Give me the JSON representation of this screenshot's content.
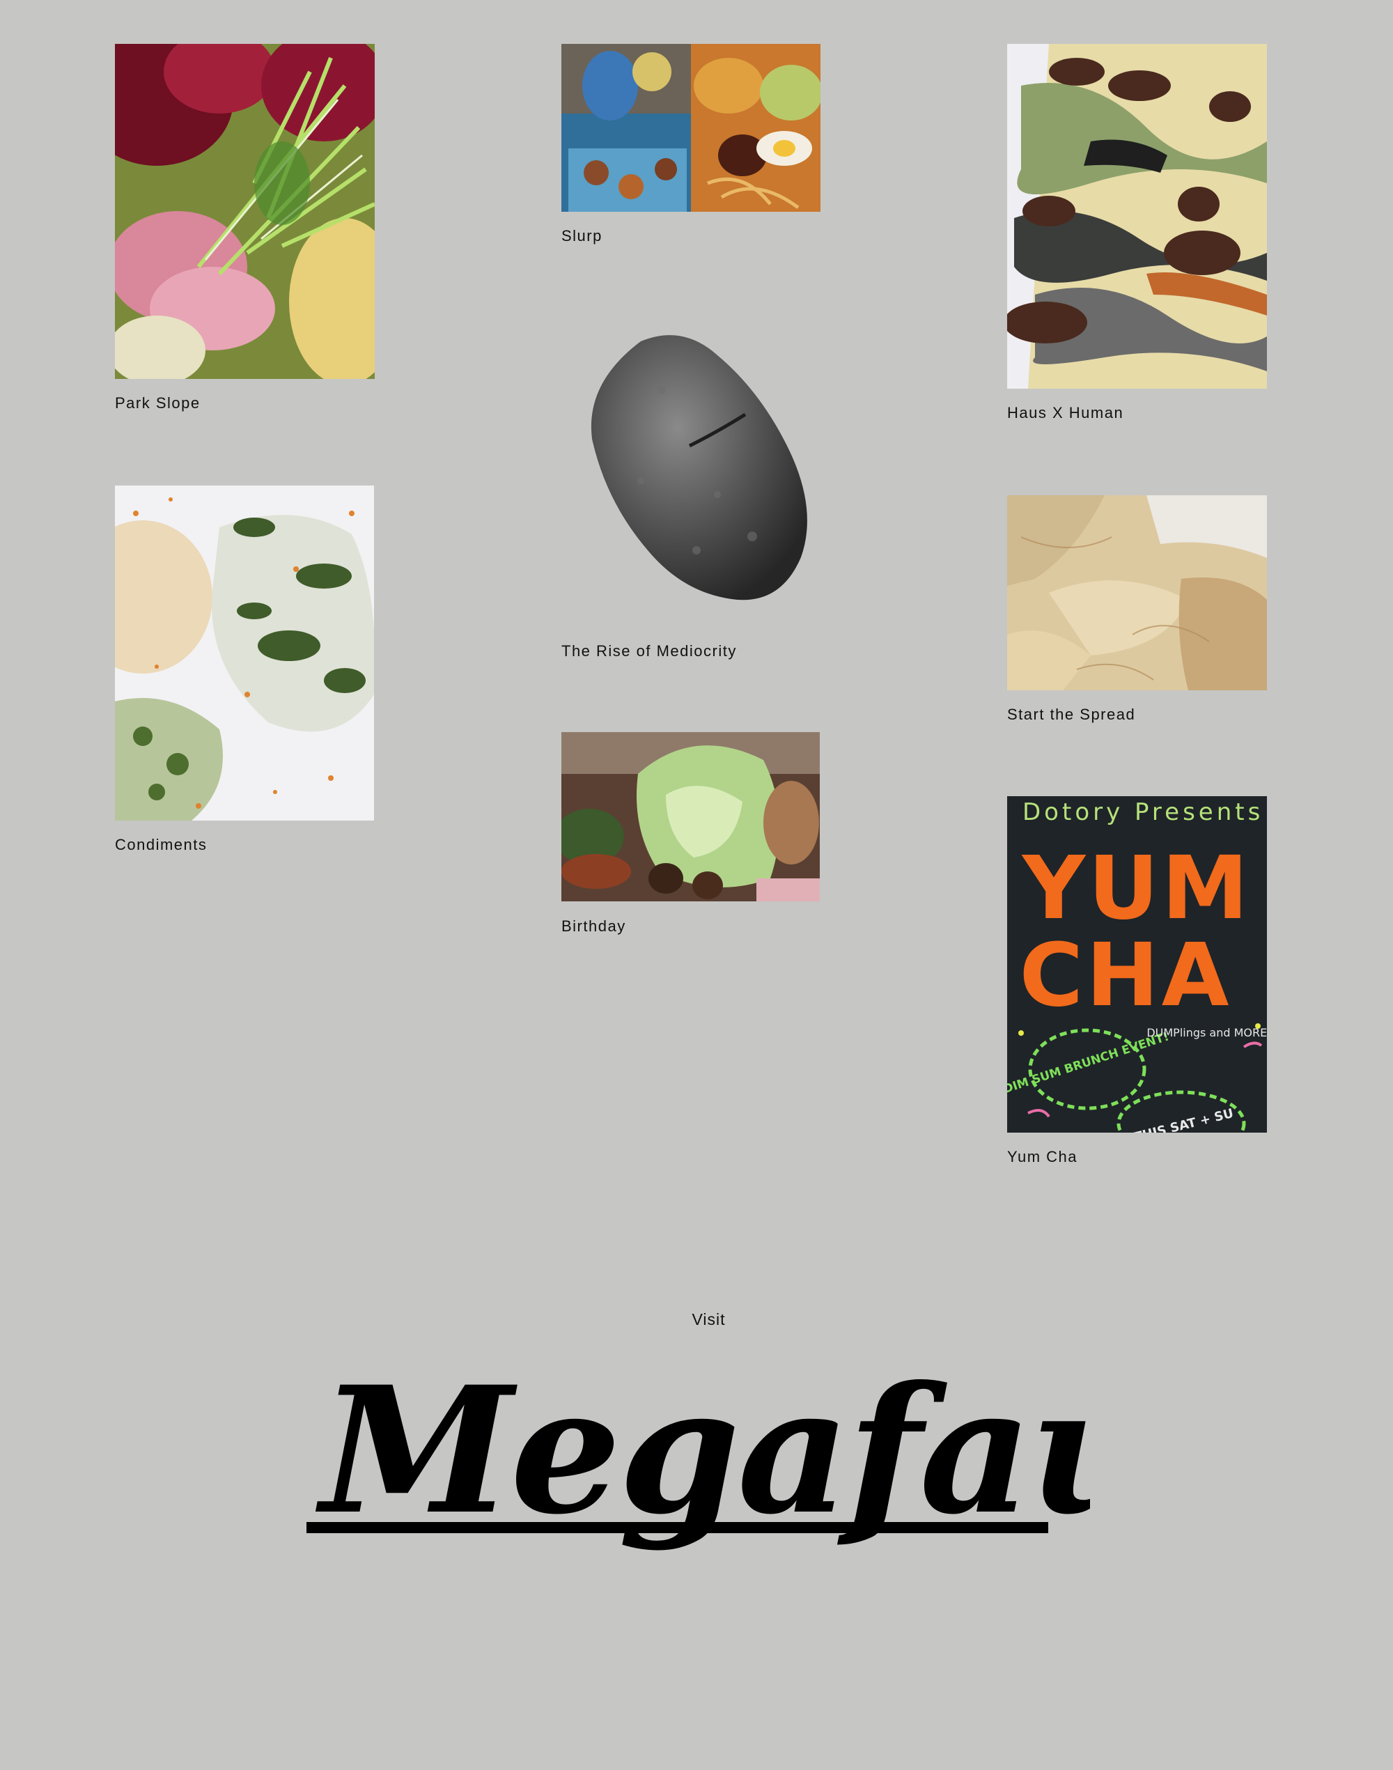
{
  "projects": [
    {
      "title": "Park Slope",
      "image": "radicchio-salad-photo"
    },
    {
      "title": "Slurp",
      "image": "noodle-bowls-photo"
    },
    {
      "title": "Haus X Human",
      "image": "camo-plating-photo"
    },
    {
      "title": "The Rise of Mediocrity",
      "image": "bread-loaf-cutout"
    },
    {
      "title": "Condiments",
      "image": "rice-balls-photo"
    },
    {
      "title": "Start the Spread",
      "image": "yuba-sheets-photo"
    },
    {
      "title": "Birthday",
      "image": "feast-table-photo"
    },
    {
      "title": "Yum Cha",
      "image": "chalkboard-poster-photo"
    }
  ],
  "poster": {
    "line1": "Dotory Presents",
    "line2": "YUM",
    "line3": "CHA",
    "badge": "DIM SUM BRUNCH EVENT!",
    "note": "DUMPlings and MORE!",
    "stamp": "THIS SAT + SU"
  },
  "footer": {
    "visit_label": "Visit",
    "brand": "Megafauna"
  },
  "colors": {
    "background": "#c6c6c4",
    "text": "#111111",
    "poster_orange": "#f26a1b",
    "poster_green": "#7ee05a"
  }
}
